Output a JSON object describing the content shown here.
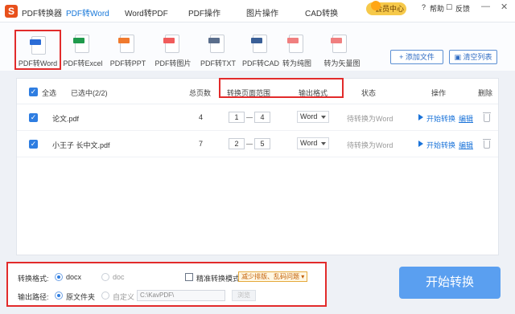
{
  "app": {
    "logo_text": "S",
    "tabs": [
      "PDF转换器",
      "PDF转Word",
      "Word转PDF",
      "PDF操作",
      "图片操作",
      "CAD转换"
    ],
    "active_tab": 1,
    "vip_label": "会员中心",
    "help_label": "帮助",
    "feedback_label": "反馈",
    "minimize_glyph": "—",
    "close_glyph": "✕"
  },
  "tools": [
    {
      "label": "PDF转Word",
      "tag_color": "#2b6cd6",
      "selected": true
    },
    {
      "label": "PDF转Excel",
      "tag_color": "#1f9a4c"
    },
    {
      "label": "PDF转PPT",
      "tag_color": "#f07a2e"
    },
    {
      "label": "PDF转图片",
      "tag_color": "#f05b5b"
    },
    {
      "label": "PDF转TXT",
      "tag_color": "#5a6e8c"
    },
    {
      "label": "PDF转CAD",
      "tag_color": "#3a5f97"
    },
    {
      "label": "转为纯图",
      "tag_color": "#f07f7f"
    },
    {
      "label": "转为矢量图",
      "tag_color": "#f07f7f"
    }
  ],
  "actions": {
    "add_file": "+ 添加文件",
    "clear_list": "清空列表"
  },
  "table": {
    "select_all": "全选",
    "selected_count": "已选中(2/2)",
    "col_pages": "总页数",
    "col_range": "转换页面范围",
    "col_format": "输出格式",
    "col_status": "状态",
    "col_action": "操作",
    "col_delete": "删除",
    "rows": [
      {
        "name": "论文.pdf",
        "pages": "4",
        "from": "1",
        "to": "4",
        "format": "Word",
        "status": "待转换为Word",
        "start": "开始转换",
        "edit": "编辑"
      },
      {
        "name": "小王子 长中文.pdf",
        "pages": "7",
        "from": "2",
        "to": "5",
        "format": "Word",
        "status": "待转换为Word",
        "start": "开始转换",
        "edit": "编辑"
      }
    ]
  },
  "options": {
    "format_label": "转换格式:",
    "format_docx": "docx",
    "format_doc": "doc",
    "precise_mode": "精准转换模式",
    "precise_hint": "减少排版、乱码问题",
    "output_label": "输出路径:",
    "source_folder": "原文件夹",
    "custom": "自定义",
    "path_value": "C:\\KavPDF\\",
    "browse": "浏览"
  },
  "start_button": "开始转换"
}
